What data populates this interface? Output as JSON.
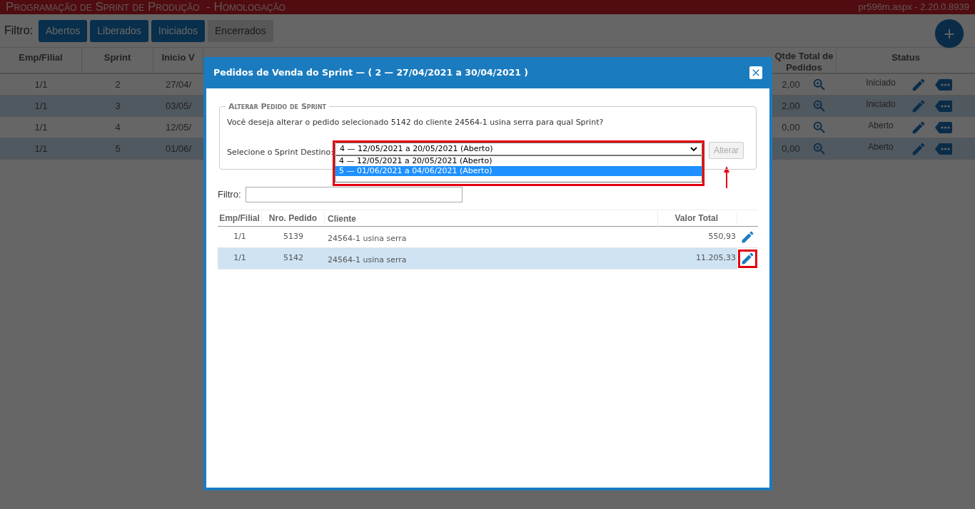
{
  "app_bar": {
    "title": "Programação de Sprint de Produção  - Homologação",
    "version": "pr596m.aspx - 2.20.0.8939"
  },
  "filter": {
    "label": "Filtro:",
    "buttons": [
      {
        "label": "Abertos",
        "selected": true
      },
      {
        "label": "Liberados",
        "selected": true
      },
      {
        "label": "Iniciados",
        "selected": true
      },
      {
        "label": "Encerrados",
        "selected": false
      }
    ]
  },
  "add_button": {
    "label": "+"
  },
  "sprints_table": {
    "columns": [
      "Emp/Filial",
      "Sprint",
      "Inicio V",
      "Qtde Total de Pedidos",
      "Status"
    ],
    "rows": [
      {
        "cells": [
          "1/1",
          "2",
          "27/04/",
          "2,00",
          "Iniciado"
        ]
      },
      {
        "cells": [
          "1/1",
          "3",
          "03/05/",
          "2,00",
          "Iniciado"
        ]
      },
      {
        "cells": [
          "1/1",
          "4",
          "12/05/",
          "0,00",
          "Aberto"
        ]
      },
      {
        "cells": [
          "1/1",
          "5",
          "01/06/",
          "0,00",
          "Aberto"
        ]
      }
    ]
  },
  "dialog": {
    "title": "Pedidos de Venda do Sprint — ( 2 — 27/04/2021 a 30/04/2021 )",
    "change_form": {
      "legend": "Alterar Pedido de Sprint",
      "question": "Você deseja alterar o pedido selecionado 5142 do cliente 24564-1 usina serra para qual Sprint?",
      "select_label": "Selecione o Sprint Destino:",
      "value": "4 — 12/05/2021 a 20/05/2021 (Aberto)",
      "options": [
        {
          "label": "4 — 12/05/2021 a 20/05/2021 (Aberto)",
          "highlighted": false
        },
        {
          "label": "5 — 01/06/2021 a 04/06/2021 (Aberto)",
          "highlighted": true
        }
      ],
      "submit": {
        "label": "Alterar",
        "disabled": true
      }
    },
    "filter": {
      "label": "Filtro:"
    },
    "orders_table": {
      "columns": [
        "Emp/Filial",
        "Nro. Pedido",
        "Cliente",
        "Valor Total"
      ],
      "rows": [
        {
          "cells": [
            "1/1",
            "5139",
            "24564-1 usina serra",
            "550,93"
          ],
          "selected": false
        },
        {
          "cells": [
            "1/1",
            "5142",
            "24564-1 usina serra",
            "11.205,33"
          ],
          "selected": true
        }
      ]
    }
  }
}
